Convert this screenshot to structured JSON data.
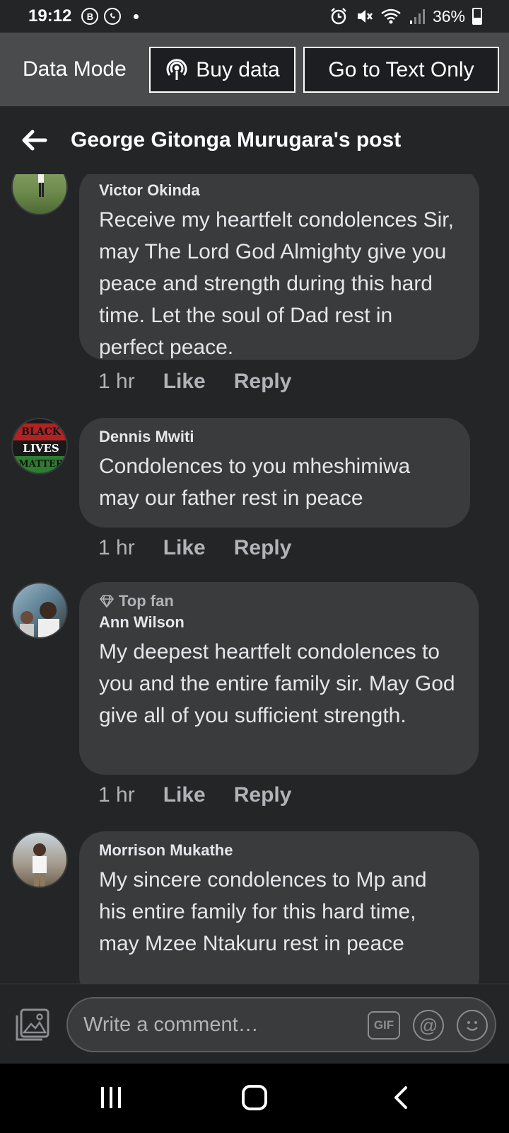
{
  "status_bar": {
    "time": "19:12",
    "battery": "36%",
    "left_icons": [
      "b-icon",
      "whatsapp-icon",
      "notification-dot"
    ],
    "right_icons": [
      "alarm-icon",
      "mute-icon",
      "wifi-icon",
      "signal-icon",
      "battery-icon"
    ]
  },
  "data_bar": {
    "label": "Data Mode",
    "buy_label": "Buy data",
    "text_only_label": "Go to Text Only"
  },
  "header": {
    "title": "George Gitonga Murugara's post"
  },
  "comments": [
    {
      "author": "Victor Okinda",
      "badge": "",
      "text": "Receive my heartfelt condolences Sir, may The Lord God Almighty give you peace and strength during this hard time. Let the soul of Dad rest in perfect peace.",
      "time": "1 hr",
      "like": "Like",
      "reply": "Reply"
    },
    {
      "author": "Dennis Mwiti",
      "badge": "",
      "text": "Condolences to you mheshimiwa may our father rest in peace",
      "time": "1 hr",
      "like": "Like",
      "reply": "Reply",
      "avatar_text": [
        "BLACK",
        "LIVES",
        "MATTER"
      ]
    },
    {
      "author": "Ann Wilson",
      "badge": "Top fan",
      "text": "My deepest heartfelt condolences to you and the entire family sir. May God give all of you sufficient strength.",
      "time": "1 hr",
      "like": "Like",
      "reply": "Reply"
    },
    {
      "author": "Morrison Mukathe",
      "badge": "",
      "text": "My sincere condolences to Mp and his entire family for this hard time, may Mzee Ntakuru rest in peace",
      "time": "",
      "like": "",
      "reply": ""
    }
  ],
  "composer": {
    "placeholder": "Write a comment…",
    "gif_label": "GIF"
  },
  "colors": {
    "background": "#242526",
    "bubble": "#3a3b3c",
    "data_bar": "#4a4b4d",
    "secondary_text": "#b0b3b8"
  }
}
